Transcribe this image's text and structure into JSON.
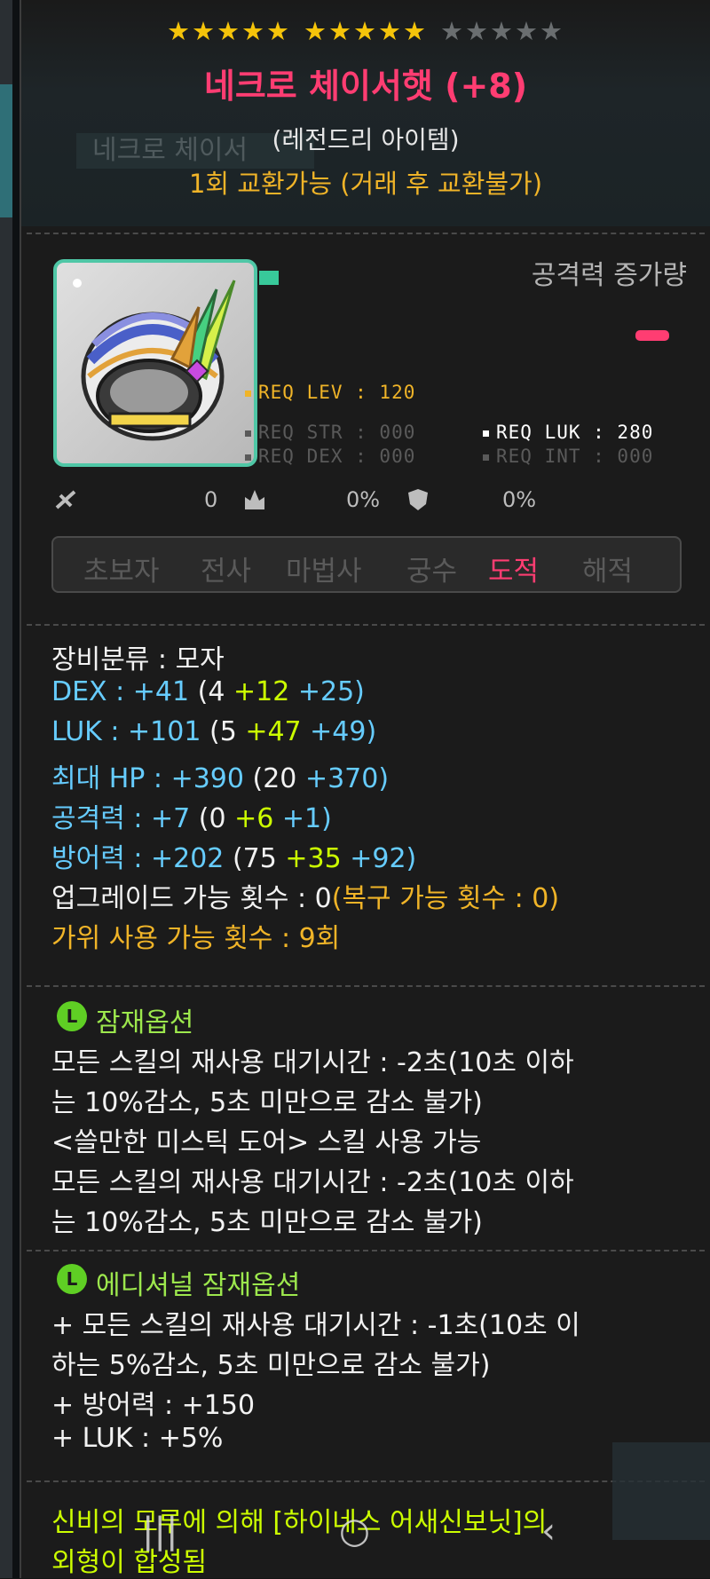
{
  "item": {
    "stars_on_group1": "★★★★★",
    "stars_on_group2": "★★★★★",
    "stars_off_group3": "★★★★★",
    "star_rating": {
      "filled": 10,
      "total": 15
    },
    "name": "네크로 체이서햇 (+8)",
    "grade": "(레전드리 아이템)",
    "trade": "1회 교환가능 (거래 후 교환불가)",
    "ghost_name": "네크로 체이서",
    "attack_change_label": "공격력 증가량",
    "req": {
      "lev": "REQ LEV : 120",
      "str": "REQ STR : 000",
      "dex": "REQ DEX : 000",
      "luk": "REQ LUK : 280",
      "int": "REQ INT : 000"
    },
    "stat_values": [
      "0",
      "0%",
      "0%"
    ],
    "jobs": [
      "초보자",
      "전사",
      "마법사",
      "궁수",
      "도적",
      "해적"
    ],
    "active_job": "도적"
  },
  "stats": {
    "category": "장비분류 : 모자",
    "dex_label": "DEX : +41",
    "dex_base": "(4 ",
    "dex_bonus1": "+12 ",
    "dex_bonus2": "+25)",
    "luk_label": "LUK : +101",
    "luk_base": "(5 ",
    "luk_bonus1": "+47 ",
    "luk_bonus2": "+49)",
    "hp_label": "최대 HP : +390",
    "hp_base": "(20 ",
    "hp_bonus": "+370)",
    "atk_label": "공격력 : +7",
    "atk_base": "(0 ",
    "atk_bonus1": "+6 ",
    "atk_bonus2": "+1)",
    "def_label": "방어력 : +202",
    "def_base": "(75 ",
    "def_bonus1": "+35 ",
    "def_bonus2": "+92)",
    "upgrade": "업그레이드 가능 횟수 : 0",
    "restore": "(복구 가능 횟수 : 0)",
    "scissors": "가위 사용 가능 횟수 : 9회"
  },
  "potential": {
    "badge": "L",
    "title": "잠재옵션",
    "lines": [
      "모든 스킬의 재사용 대기시간 : -2초(10초 이하",
      "는 10%감소, 5초 미만으로 감소 불가)",
      "<쓸만한 미스틱 도어> 스킬 사용 가능",
      "모든 스킬의 재사용 대기시간 : -2초(10초 이하",
      "는 10%감소, 5초 미만으로 감소 불가)"
    ]
  },
  "additional": {
    "badge": "L",
    "title": "에디셔널 잠재옵션",
    "lines": [
      "+ 모든 스킬의 재사용 대기시간 : -1초(10초 이",
      "하는 5%감소, 5초 미만으로 감소 불가)",
      "+ 방어력 : +150",
      "+ LUK : +5%"
    ]
  },
  "footer": {
    "lines": [
      "신비의 모루에 의해 [하이네스 어새신보닛]의",
      "외형이 합성됨"
    ]
  },
  "nav": {
    "recent": "|||",
    "home": "○",
    "back": "‹"
  },
  "colors": {
    "name_pink": "#ff3d72",
    "gold": "#f0b428",
    "cyan": "#66ccff",
    "lime": "#ccff00",
    "potential_green": "#9de84d",
    "icon_border": "#4fc7a6"
  }
}
